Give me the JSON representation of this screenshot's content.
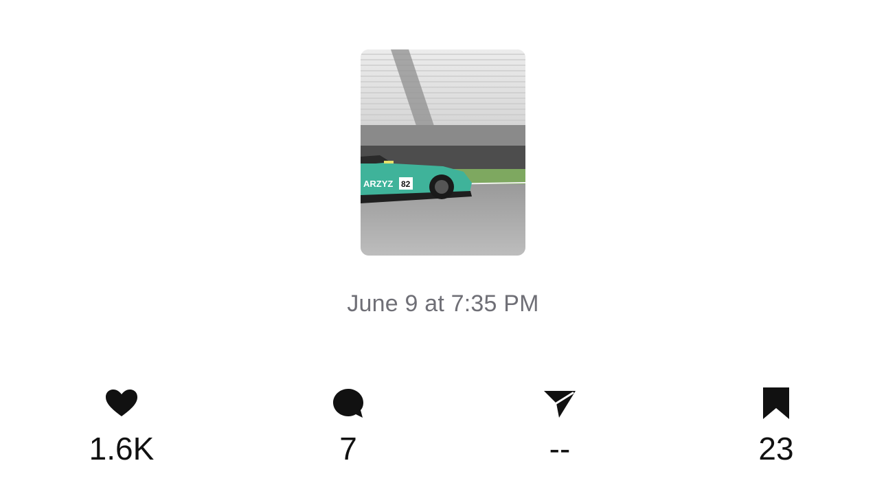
{
  "post": {
    "image": {
      "description": "motion-blurred teal race car on track",
      "car_sponsor_text": "ARZYZ",
      "car_number": "82"
    },
    "timestamp": "June 9 at 7:35 PM"
  },
  "stats": {
    "likes": {
      "icon": "heart-icon",
      "count": "1.6K"
    },
    "comments": {
      "icon": "comment-icon",
      "count": "7"
    },
    "shares": {
      "icon": "send-icon",
      "count": "--"
    },
    "saves": {
      "icon": "bookmark-icon",
      "count": "23"
    }
  },
  "colors": {
    "text": "#111111",
    "timestamp": "#6f6f76",
    "car_teal": "#3fb39a",
    "background": "#ffffff"
  }
}
